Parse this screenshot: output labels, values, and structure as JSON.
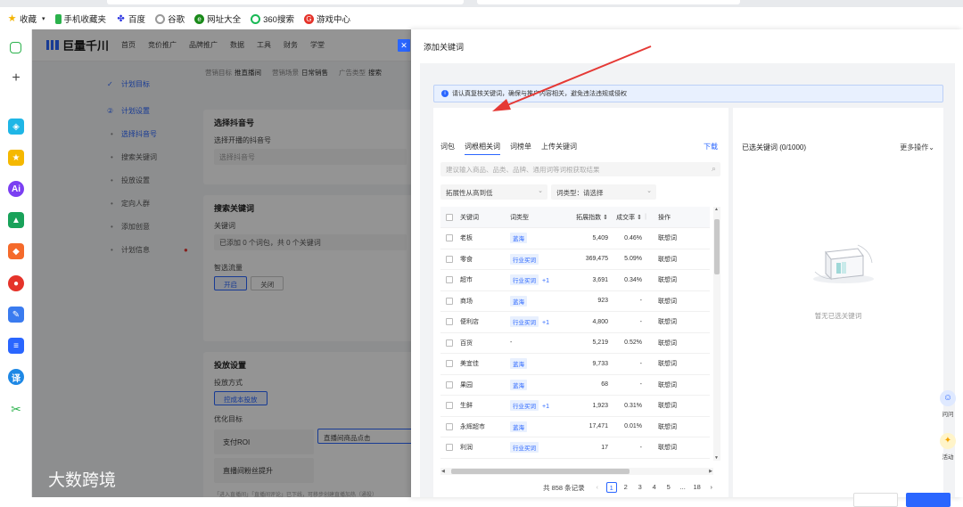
{
  "browser": {
    "bookmarks": [
      {
        "label": "收藏",
        "icon": "star-icon"
      },
      {
        "label": "手机收藏夹",
        "icon": "phone-icon"
      },
      {
        "label": "百度",
        "icon": "baidu-icon"
      },
      {
        "label": "谷歌",
        "icon": "google-icon"
      },
      {
        "label": "网址大全",
        "icon": "globe-icon"
      },
      {
        "label": "360搜索",
        "icon": "search-360-icon"
      },
      {
        "label": "游戏中心",
        "icon": "game-icon"
      }
    ]
  },
  "app": {
    "logo": "巨量千川",
    "nav": [
      "首页",
      "竞价推广",
      "品牌推广",
      "数据",
      "工具",
      "财务",
      "学堂"
    ],
    "steps": {
      "goal": "计划目标",
      "settings": "计划设置",
      "sub": [
        "选择抖音号",
        "搜索关键词",
        "投放设置",
        "定向人群",
        "添加创意",
        "计划信息"
      ]
    },
    "crumbs": [
      {
        "k": "营销目标",
        "v": "推直播间"
      },
      {
        "k": "营销场景",
        "v": "日常销售"
      },
      {
        "k": "广告类型",
        "v": "搜索"
      }
    ],
    "card1": {
      "title": "选择抖音号",
      "label": "选择开播的抖音号",
      "placeholder": "选择抖音号"
    },
    "card2": {
      "title": "搜索关键词",
      "label": "关键词",
      "value": "已添加 0 个词包，共 0 个关键词",
      "flow_label": "智选流量",
      "on": "开启",
      "off": "关闭"
    },
    "card3": {
      "title": "投放设置",
      "method_label": "投放方式",
      "method_btn": "控成本投放",
      "goal_label": "优化目标",
      "opt1": "支付ROI",
      "opt2": "直播间商品点击",
      "opt3": "直播间粉丝提升",
      "footnote": "「进入直播间」「直播间评论」已下线，可移步创建直播加热（通投）"
    }
  },
  "watermark": "大数跨境",
  "drawer": {
    "title": "添加关键词",
    "notice": "请认真复核关键词，确保与推广内容相关，避免违法违规或侵权",
    "tabs": [
      "词包",
      "词根相关词",
      "词榜单",
      "上传关键词"
    ],
    "active_tab": "词根相关词",
    "download": "下载",
    "search_placeholder": "建议输入商品、品类、品牌、通用词等词根获取结果",
    "sort_select": "拓展性从高到低",
    "type_select": "词类型：请选择",
    "columns": [
      "关键词",
      "词类型",
      "拓展指数",
      "成交率",
      "操作"
    ],
    "rows": [
      {
        "kw": "老板",
        "type": "蓝海",
        "plus": "",
        "idx": "5,409",
        "rate": "0.46%",
        "op": "联想词"
      },
      {
        "kw": "零食",
        "type": "行业买词",
        "plus": "",
        "idx": "369,475",
        "rate": "5.09%",
        "op": "联想词"
      },
      {
        "kw": "超市",
        "type": "行业买词",
        "plus": "+1",
        "idx": "3,691",
        "rate": "0.34%",
        "op": "联想词"
      },
      {
        "kw": "商场",
        "type": "蓝海",
        "plus": "",
        "idx": "923",
        "rate": "-",
        "op": "联想词"
      },
      {
        "kw": "便利店",
        "type": "行业买词",
        "plus": "+1",
        "idx": "4,800",
        "rate": "-",
        "op": "联想词"
      },
      {
        "kw": "百货",
        "type": "-",
        "plus": "",
        "idx": "5,219",
        "rate": "0.52%",
        "op": "联想词"
      },
      {
        "kw": "美宜佳",
        "type": "蓝海",
        "plus": "",
        "idx": "9,733",
        "rate": "-",
        "op": "联想词"
      },
      {
        "kw": "果园",
        "type": "蓝海",
        "plus": "",
        "idx": "68",
        "rate": "-",
        "op": "联想词"
      },
      {
        "kw": "生鲜",
        "type": "行业买词",
        "plus": "+1",
        "idx": "1,923",
        "rate": "0.31%",
        "op": "联想词"
      },
      {
        "kw": "永辉超市",
        "type": "蓝海",
        "plus": "",
        "idx": "17,471",
        "rate": "0.01%",
        "op": "联想词"
      },
      {
        "kw": "利润",
        "type": "行业买词",
        "plus": "",
        "idx": "17",
        "rate": "-",
        "op": "联想词"
      }
    ],
    "total": "共 858 条记录",
    "pages": [
      "1",
      "2",
      "3",
      "4",
      "5",
      "...",
      "18"
    ],
    "selected_title": "已选关键词 (0/1000)",
    "more_ops": "更多操作",
    "empty_text": "暂无已选关键词"
  },
  "floating": {
    "ask": "问问",
    "activity": "活动"
  },
  "colors": {
    "primary": "#2a66ff",
    "arrow": "#e53935"
  }
}
